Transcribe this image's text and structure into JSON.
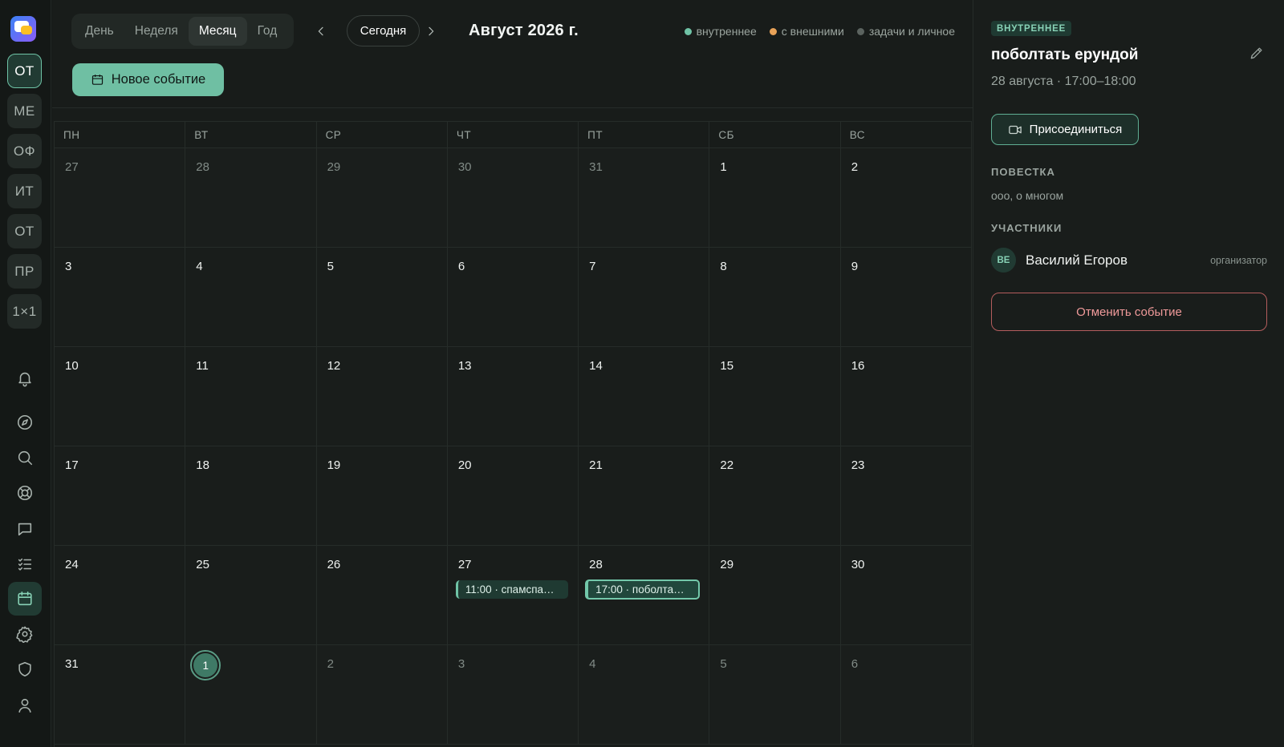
{
  "colors": {
    "accent": "#6fbfa3",
    "internal": "#6fc3a6",
    "external": "#e8a258",
    "tasks": "#5b635f",
    "danger": "#b45d5d"
  },
  "rail": {
    "workspaces": [
      {
        "label": "ОТ",
        "active": true
      },
      {
        "label": "МЕ",
        "active": false
      },
      {
        "label": "ОФ",
        "active": false
      },
      {
        "label": "ИТ",
        "active": false
      },
      {
        "label": "ОТ",
        "active": false
      },
      {
        "label": "ПР",
        "active": false
      },
      {
        "label": "1×1",
        "active": false
      }
    ],
    "icons": [
      "bell-icon",
      "compass-icon",
      "search-icon",
      "lifebuoy-icon",
      "chat-icon",
      "tasks-icon",
      "calendar-icon",
      "gear-icon",
      "shield-icon",
      "user-icon"
    ],
    "active_icon": "calendar-icon"
  },
  "toolbar": {
    "views": [
      "День",
      "Неделя",
      "Месяц",
      "Год"
    ],
    "active_view": "Месяц",
    "today_label": "Сегодня",
    "month_title": "Август 2026 г.",
    "new_event_label": "Новое событие"
  },
  "legend": [
    {
      "label": "внутреннее",
      "color": "#6fc3a6"
    },
    {
      "label": "с внешними",
      "color": "#e8a258"
    },
    {
      "label": "задачи и личное",
      "color": "#5b635f"
    }
  ],
  "calendar": {
    "weekdays": [
      "ПН",
      "ВТ",
      "СР",
      "ЧТ",
      "ПТ",
      "СБ",
      "ВС"
    ],
    "weeks": [
      [
        {
          "d": "27",
          "other": true
        },
        {
          "d": "28",
          "other": true
        },
        {
          "d": "29",
          "other": true
        },
        {
          "d": "30",
          "other": true
        },
        {
          "d": "31",
          "other": true
        },
        {
          "d": "1"
        },
        {
          "d": "2"
        }
      ],
      [
        {
          "d": "3"
        },
        {
          "d": "4"
        },
        {
          "d": "5"
        },
        {
          "d": "6"
        },
        {
          "d": "7"
        },
        {
          "d": "8"
        },
        {
          "d": "9"
        }
      ],
      [
        {
          "d": "10"
        },
        {
          "d": "11"
        },
        {
          "d": "12"
        },
        {
          "d": "13"
        },
        {
          "d": "14"
        },
        {
          "d": "15"
        },
        {
          "d": "16"
        }
      ],
      [
        {
          "d": "17"
        },
        {
          "d": "18"
        },
        {
          "d": "19"
        },
        {
          "d": "20"
        },
        {
          "d": "21"
        },
        {
          "d": "22"
        },
        {
          "d": "23"
        }
      ],
      [
        {
          "d": "24"
        },
        {
          "d": "25"
        },
        {
          "d": "26"
        },
        {
          "d": "27",
          "events": [
            {
              "label": "11:00 · спамспа…",
              "selected": false
            }
          ]
        },
        {
          "d": "28",
          "events": [
            {
              "label": "17:00 · поболта…",
              "selected": true
            }
          ]
        },
        {
          "d": "29"
        },
        {
          "d": "30"
        }
      ],
      [
        {
          "d": "31"
        },
        {
          "d": "1",
          "other": true,
          "today": true
        },
        {
          "d": "2",
          "other": true
        },
        {
          "d": "3",
          "other": true
        },
        {
          "d": "4",
          "other": true
        },
        {
          "d": "5",
          "other": true
        },
        {
          "d": "6",
          "other": true
        }
      ]
    ]
  },
  "panel": {
    "category": "ВНУТРЕННЕЕ",
    "title": "поболтать ерундой",
    "datetime": "28 августа · 17:00–18:00",
    "join_label": "Присоединиться",
    "agenda_heading": "ПОВЕСТКА",
    "agenda_text": "ооо, о многом",
    "participants_heading": "УЧАСТНИКИ",
    "participants": [
      {
        "initials": "ВЕ",
        "name": "Василий Егоров",
        "role": "организатор"
      }
    ],
    "cancel_label": "Отменить событие"
  }
}
